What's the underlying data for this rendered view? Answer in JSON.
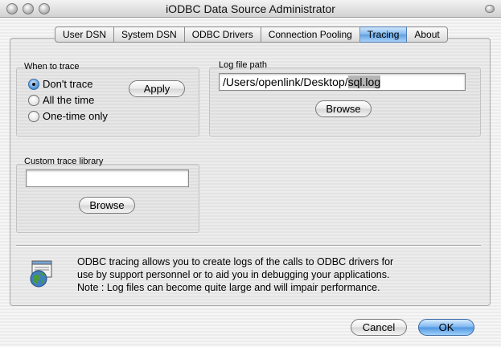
{
  "window": {
    "title": "iODBC Data Source Administrator"
  },
  "tabs": [
    {
      "label": "User DSN",
      "active": false
    },
    {
      "label": "System DSN",
      "active": false
    },
    {
      "label": "ODBC Drivers",
      "active": false
    },
    {
      "label": "Connection Pooling",
      "active": false
    },
    {
      "label": "Tracing",
      "active": true
    },
    {
      "label": "About",
      "active": false
    }
  ],
  "when_to_trace": {
    "label": "When to trace",
    "options": [
      {
        "label": "Don't trace",
        "selected": true
      },
      {
        "label": "All the time",
        "selected": false
      },
      {
        "label": "One-time only",
        "selected": false
      }
    ],
    "apply_label": "Apply"
  },
  "log_file": {
    "label": "Log file path",
    "value_prefix": "/Users/openlink/Desktop/",
    "value_selected": "sql.log",
    "browse_label": "Browse"
  },
  "custom_library": {
    "label": "Custom trace library",
    "value": "",
    "browse_label": "Browse"
  },
  "info": {
    "icon": "odbc-trace-globe-icon",
    "lines": [
      "ODBC tracing allows you to create logs of the calls to ODBC drivers for",
      "use by support personnel or to aid you in debugging your applications.",
      "Note : Log files can become quite large and will impair performance."
    ]
  },
  "footer": {
    "cancel_label": "Cancel",
    "ok_label": "OK"
  },
  "colors": {
    "accent": "#5f9fe0",
    "panel": "#e4e4e4"
  }
}
